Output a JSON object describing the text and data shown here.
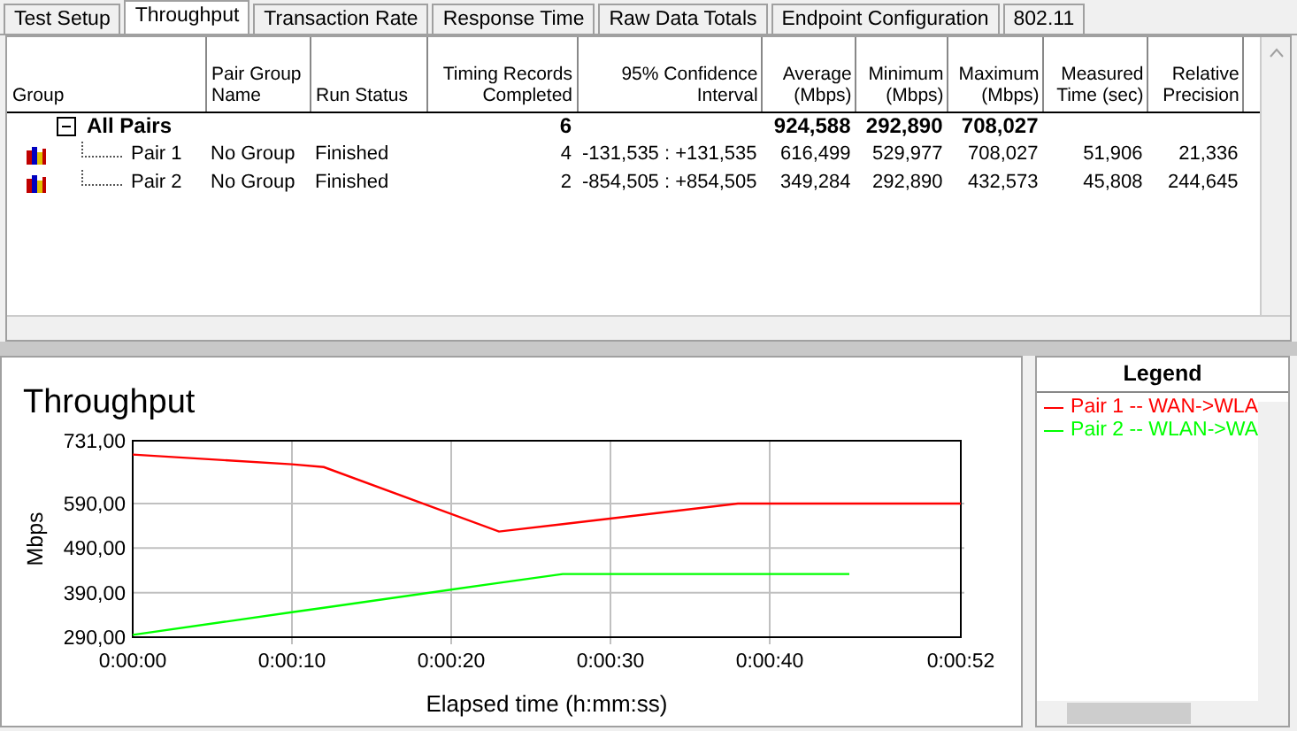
{
  "tabs": [
    {
      "label": "Test Setup",
      "selected": false
    },
    {
      "label": "Throughput",
      "selected": true
    },
    {
      "label": "Transaction Rate",
      "selected": false
    },
    {
      "label": "Response Time",
      "selected": false
    },
    {
      "label": "Raw Data Totals",
      "selected": false
    },
    {
      "label": "Endpoint Configuration",
      "selected": false
    },
    {
      "label": "802.11",
      "selected": false
    }
  ],
  "table": {
    "columns": [
      "Group",
      "Pair Group Name",
      "Run Status",
      "Timing Records Completed",
      "95% Confidence Interval",
      "Average (Mbps)",
      "Minimum (Mbps)",
      "Maximum (Mbps)",
      "Measured Time (sec)",
      "Relative Precision"
    ],
    "rows": [
      {
        "cells": [
          "All Pairs",
          null,
          null,
          "6",
          null,
          "924,588",
          "292,890",
          "708,027",
          null,
          null
        ],
        "expanded": true,
        "children": [
          {
            "cells": [
              "Pair 1",
              "No Group",
              "Finished",
              "4",
              "-131,535 : +131,535",
              "616,499",
              "529,977",
              "708,027",
              "51,906",
              "21,336"
            ]
          },
          {
            "cells": [
              "Pair 2",
              "No Group",
              "Finished",
              "2",
              "-854,505 : +854,505",
              "349,284",
              "292,890",
              "432,573",
              "45,808",
              "244,645"
            ]
          }
        ]
      }
    ]
  },
  "chart": {
    "chart_data": {
      "type": "line",
      "title": "Throughput",
      "xlabel": "Elapsed time (h:mm:ss)",
      "ylabel": "Mbps",
      "grid": true,
      "x": [
        0,
        10,
        12,
        23,
        27,
        38,
        45,
        52
      ],
      "series": [
        {
          "name": "Pair 1 -- WAN->WLA",
          "color": "#ff0000",
          "values": [
            700,
            678,
            672,
            527,
            544,
            590,
            590,
            590
          ]
        },
        {
          "name": "Pair 2 -- WLAN->WA",
          "color": "#00ff00",
          "values": [
            295,
            346,
            356,
            412,
            432,
            432,
            432,
            null
          ]
        }
      ],
      "xlim": [
        0,
        52
      ],
      "ylim": [
        290,
        731
      ],
      "xticks": [
        {
          "value": 0,
          "label": "0:00:00"
        },
        {
          "value": 10,
          "label": "0:00:10"
        },
        {
          "value": 20,
          "label": "0:00:20"
        },
        {
          "value": 30,
          "label": "0:00:30"
        },
        {
          "value": 40,
          "label": "0:00:40"
        },
        {
          "value": 52,
          "label": "0:00:52"
        }
      ],
      "yticks": [
        {
          "value": 290,
          "label": "290,00"
        },
        {
          "value": 390,
          "label": "390,00"
        },
        {
          "value": 490,
          "label": "490,00"
        },
        {
          "value": 590,
          "label": "590,00"
        },
        {
          "value": 731,
          "label": "731,00"
        }
      ]
    }
  },
  "legend": {
    "title": "Legend"
  }
}
